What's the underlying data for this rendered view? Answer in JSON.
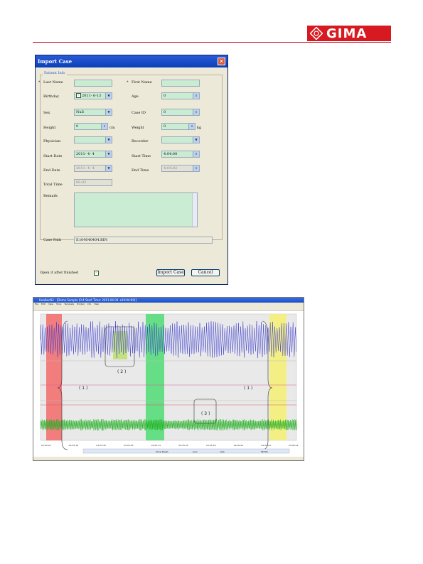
{
  "brand": {
    "name": "GIMA",
    "accent": "#d71a21"
  },
  "dialog": {
    "title": "Import Case",
    "group_legend": "Patient Info",
    "last_name_label": "Last Name",
    "first_name_label": "First Name",
    "birthday_label": "Birthday",
    "birthday_value": "2011- 6-13",
    "age_label": "Age",
    "age_value": "0",
    "sex_label": "Sex",
    "sex_value": "Null",
    "case_id_label": "Case ID",
    "case_id_value": "0",
    "height_label": "Height",
    "height_value": "0",
    "height_unit": "cm",
    "weight_label": "Weight",
    "weight_value": "0",
    "weight_unit": "kg",
    "physician_label": "Physician",
    "recorder_label": "Recorder",
    "start_date_label": "Start Date",
    "start_date_value": "2011- 4- 4",
    "start_time_label": "Start Time",
    "start_time_value": "4:04:00",
    "end_date_label": "End Date",
    "end_date_value": "2011- 4- 4",
    "end_time_label": "End Time",
    "end_time_value": "4:04:02",
    "total_time_label": "Total Time",
    "total_time_value": "00:02",
    "remark_label": "Remark",
    "case_path_label": "Case Path",
    "case_path_value": "E:\\04040404.BIN",
    "open_after_label": "Open it after finished",
    "import_button": "Import Case",
    "cancel_button": "Cancel",
    "required_mark": "*"
  },
  "viewer": {
    "title": "HeaRecN3 - [Demo Sample (0:4 Start Time: 2011.04.04 +04:04:00)]",
    "menu": [
      "File",
      "Edit",
      "View",
      "Tools",
      "Template",
      "Printed",
      "Info",
      "Help"
    ],
    "callout_1": "( 1 )",
    "callout_2": "( 2 )",
    "callout_3": "( 3 )",
    "time_ticks": [
      "04:04:00",
      "04:04:18",
      "04:04:36",
      "04:04:54",
      "04:05:12",
      "04:05:30",
      "04:05:48",
      "04:06:06",
      "04:06:24",
      "04:06:42"
    ],
    "bottom_controls": [
      "Show Beats",
      "prev",
      "next",
      "PR Min"
    ]
  }
}
